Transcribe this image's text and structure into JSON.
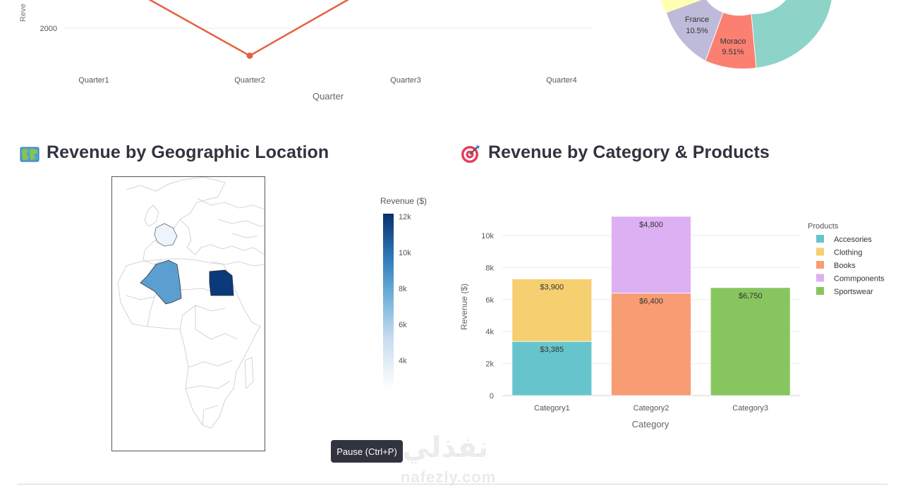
{
  "top_line": {
    "ylabel_fragment": "Reve",
    "y_tick": "2000",
    "xlabel": "Quarter",
    "categories": [
      "Quarter1",
      "Quarter2",
      "Quarter3",
      "Quarter4"
    ],
    "line_color": "#e4613f"
  },
  "top_donut": {
    "slices": [
      {
        "label": "France",
        "pct": "10.5%",
        "color": "#bebada"
      },
      {
        "label": "Moraco",
        "pct": "9.51%",
        "color": "#fb8072"
      }
    ],
    "other_colors": [
      "#8dd3c7",
      "#ffffb3"
    ]
  },
  "geo": {
    "title": "Revenue by Geographic Location",
    "icon": "map-icon",
    "colorbar": {
      "title": "Revenue ($)",
      "ticks": [
        "12k",
        "10k",
        "8k",
        "6k",
        "4k"
      ]
    },
    "highlighted_countries": [
      {
        "name": "Egypt",
        "color": "#0b3a7a"
      },
      {
        "name": "Algeria",
        "color": "#5b9fd1"
      },
      {
        "name": "France",
        "color": "#eef4fb"
      }
    ]
  },
  "category": {
    "title": "Revenue by Category & Products",
    "icon": "target-icon",
    "chart_data": {
      "type": "bar",
      "stacked": true,
      "categories": [
        "Category1",
        "Category2",
        "Category3"
      ],
      "xlabel": "Category",
      "ylabel": "Revenue ($)",
      "ylim": [
        0,
        11500
      ],
      "y_ticks": [
        "0",
        "2k",
        "4k",
        "6k",
        "8k",
        "10k"
      ],
      "y_tick_values": [
        0,
        2000,
        4000,
        6000,
        8000,
        10000
      ],
      "legend_title": "Products",
      "legend_position": "right",
      "series": [
        {
          "name": "Accesories",
          "color": "#66c5cc",
          "values": [
            3385,
            0,
            0
          ],
          "labels": [
            "$3,385",
            "",
            ""
          ]
        },
        {
          "name": "Clothing",
          "color": "#f6cf71",
          "values": [
            3900,
            0,
            0
          ],
          "labels": [
            "$3,900",
            "",
            ""
          ]
        },
        {
          "name": "Books",
          "color": "#f89c74",
          "values": [
            0,
            6400,
            0
          ],
          "labels": [
            "",
            "$6,400",
            ""
          ]
        },
        {
          "name": "Commponents",
          "color": "#dcb0f2",
          "values": [
            0,
            4800,
            0
          ],
          "labels": [
            "",
            "$4,800",
            ""
          ]
        },
        {
          "name": "Sportswear",
          "color": "#87c55f",
          "values": [
            0,
            0,
            6750
          ],
          "labels": [
            "",
            "",
            "$6,750"
          ]
        }
      ]
    }
  },
  "tooltip": {
    "text": "Pause (Ctrl+P)"
  },
  "watermark": {
    "arabic": "نفذلي",
    "latin": "nafezly.com"
  }
}
